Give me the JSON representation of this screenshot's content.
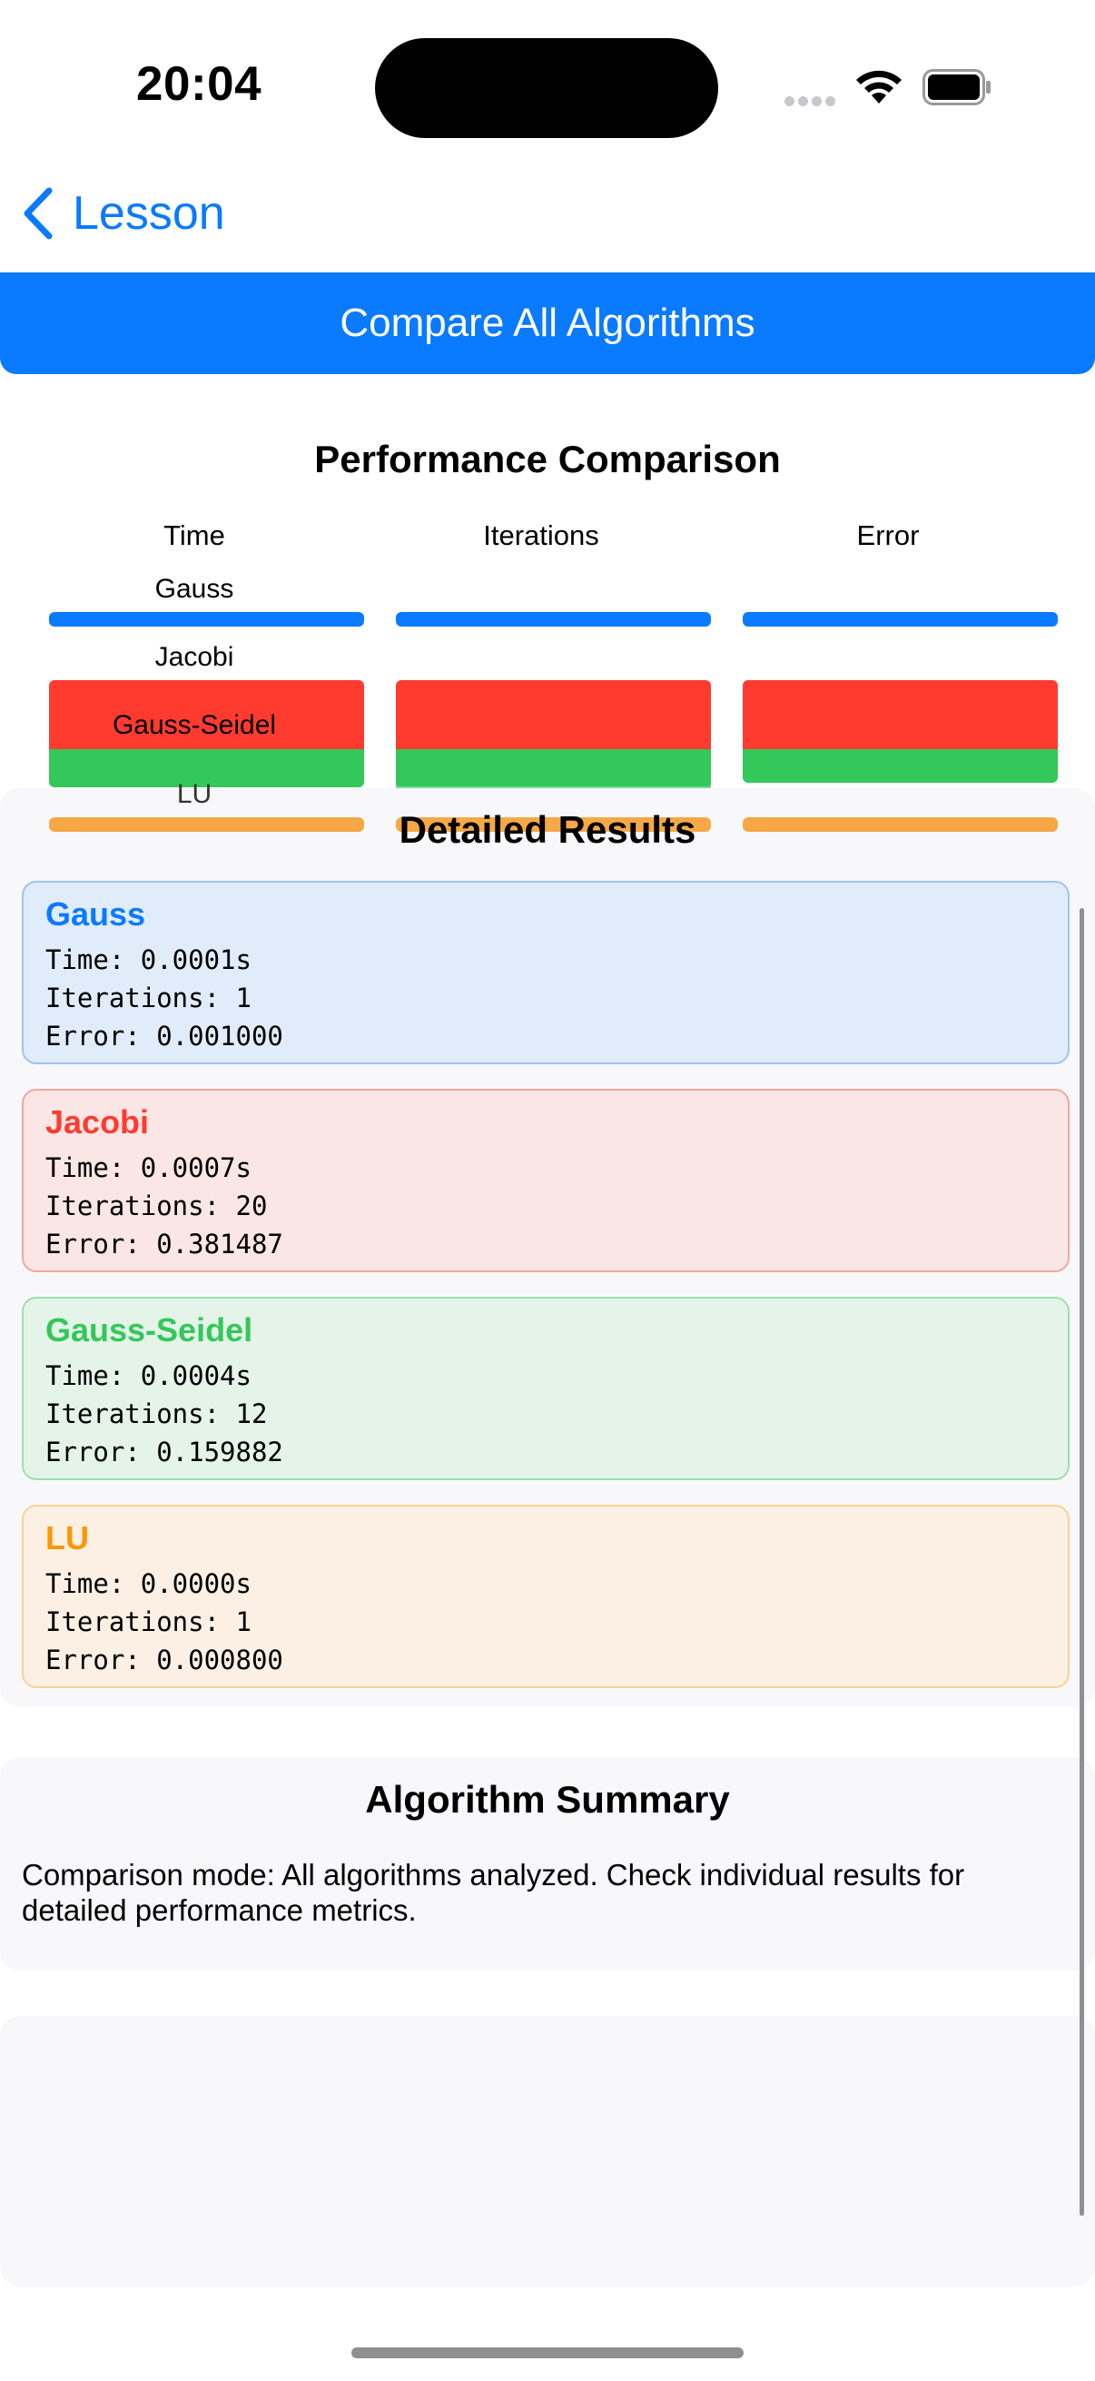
{
  "status_bar": {
    "time": "20:04"
  },
  "nav": {
    "back_label": "Lesson"
  },
  "compare_button": {
    "label": "Compare All Algorithms"
  },
  "performance": {
    "title": "Performance Comparison",
    "columns": [
      "Time",
      "Iterations",
      "Error"
    ],
    "algorithms": [
      "Gauss",
      "Jacobi",
      "Gauss-Seidel",
      "LU"
    ]
  },
  "details": {
    "title": "Detailed Results",
    "cards": [
      {
        "name": "Gauss",
        "time": "Time: 0.0001s",
        "iterations": "Iterations: 1",
        "error": "Error: 0.001000",
        "color": "#0a7aff"
      },
      {
        "name": "Jacobi",
        "time": "Time: 0.0007s",
        "iterations": "Iterations: 20",
        "error": "Error: 0.381487",
        "color": "#ff3b30"
      },
      {
        "name": "Gauss-Seidel",
        "time": "Time: 0.0004s",
        "iterations": "Iterations: 12",
        "error": "Error: 0.159882",
        "color": "#34c759"
      },
      {
        "name": "LU",
        "time": "Time: 0.0000s",
        "iterations": "Iterations: 1",
        "error": "Error: 0.000800",
        "color": "#ff9500"
      }
    ]
  },
  "summary": {
    "title": "Algorithm Summary",
    "text": "Comparison mode: All algorithms analyzed. Check individual results for detailed performance metrics."
  }
}
